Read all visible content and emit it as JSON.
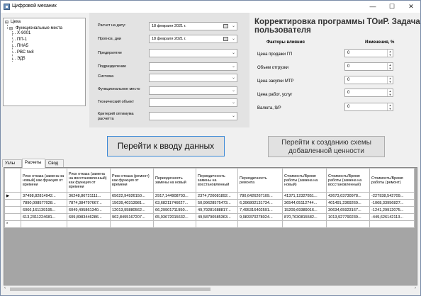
{
  "window": {
    "title": "Цифровой механик",
    "minimize": "—",
    "maximize": "☐",
    "close": "✕"
  },
  "tree": {
    "root": "Цеха",
    "child": "Функциональные места",
    "items": [
      "Х-9001",
      "ПП-1",
      "ПНА5",
      "РВС №8",
      "ЭД5"
    ],
    "minus1": "⊟",
    "minus2": "⊟"
  },
  "form": {
    "date_label": "Расчет на дату:",
    "date_value": "18 февраля  2021 г.",
    "forecast_label": "Прогноз, дни",
    "forecast_value": "18 февраля  2021 г.",
    "enterprise_label": "Предприятие",
    "division_label": "Подразделение",
    "system_label": "Система",
    "func_place_label": "Функциональное место",
    "tech_object_label": "Технический объект",
    "criterion_label": "Критерий оптимума расчетта"
  },
  "buttons": {
    "go_input": "Перейти к вводу данных",
    "go_scheme": "Перейти к созданию схемы добавленной ценности"
  },
  "right": {
    "title": "Корректировка программы ТОиР.  Задача пользователя",
    "col_factors": "Факторы влияния",
    "col_changes": "Изменения, %",
    "factors": [
      {
        "label": "Цена продажи ГП",
        "value": "0"
      },
      {
        "label": "Объем отгрузки",
        "value": "0"
      },
      {
        "label": "Цена закупки МТР",
        "value": "0"
      },
      {
        "label": "Цена работ, услуг",
        "value": "0"
      },
      {
        "label": "Валюта, $/Р",
        "value": "0"
      }
    ]
  },
  "tabs": [
    "Узлы",
    "Расчеты",
    "Свод"
  ],
  "grid": {
    "headers": [
      "Риск отказа (замена на новый) как функция от времени",
      "Риск отказа (замена на восстановленный) как функция от времени",
      "Риск отказа (ремонт) как функция от времени",
      "Периодичность замены на новый",
      "Периодичность замены на восстановленный",
      "Периодичность ремонта",
      "Стоимость/Время работы (замена на новый)",
      "Стоимость/Время работы (замена на восстановленный)",
      "Стоимость/Время работы (ремонт)"
    ],
    "rows": [
      [
        "37498,82814942...",
        "36248,86721111...",
        "65622,94926150...",
        "2917,144908703...",
        "2374,720081892...",
        "780,6426267109...",
        "41371,12327851...",
        "42673,03730978...",
        "-227938,542709..."
      ],
      [
        "7890,008577028...",
        "7874,384797667...",
        "15639,40313981...",
        "63,68211746027...",
        "50,99628575473...",
        "6,396802131734...",
        "36544,05112744...",
        "401491,2369269...",
        "-1068,33956827..."
      ],
      [
        "6066,161139195...",
        "6049,495861340...",
        "12013,95880562...",
        "66,29901711950...",
        "49,79281688817...",
        "7,495316402591...",
        "15209,69389016...",
        "30634,65923167...",
        "-1241,29912075..."
      ],
      [
        "613,2311224681...",
        "609,8983446286...",
        "902,8495167207...",
        "65,93672015632...",
        "49,58790585363...",
        "9,983370278024...",
        "870,7630815582...",
        "1013,927790239...",
        "-449,626142113..."
      ]
    ],
    "row_markers": [
      "▶",
      "",
      "",
      "",
      ""
    ],
    "new_marker": "*"
  }
}
